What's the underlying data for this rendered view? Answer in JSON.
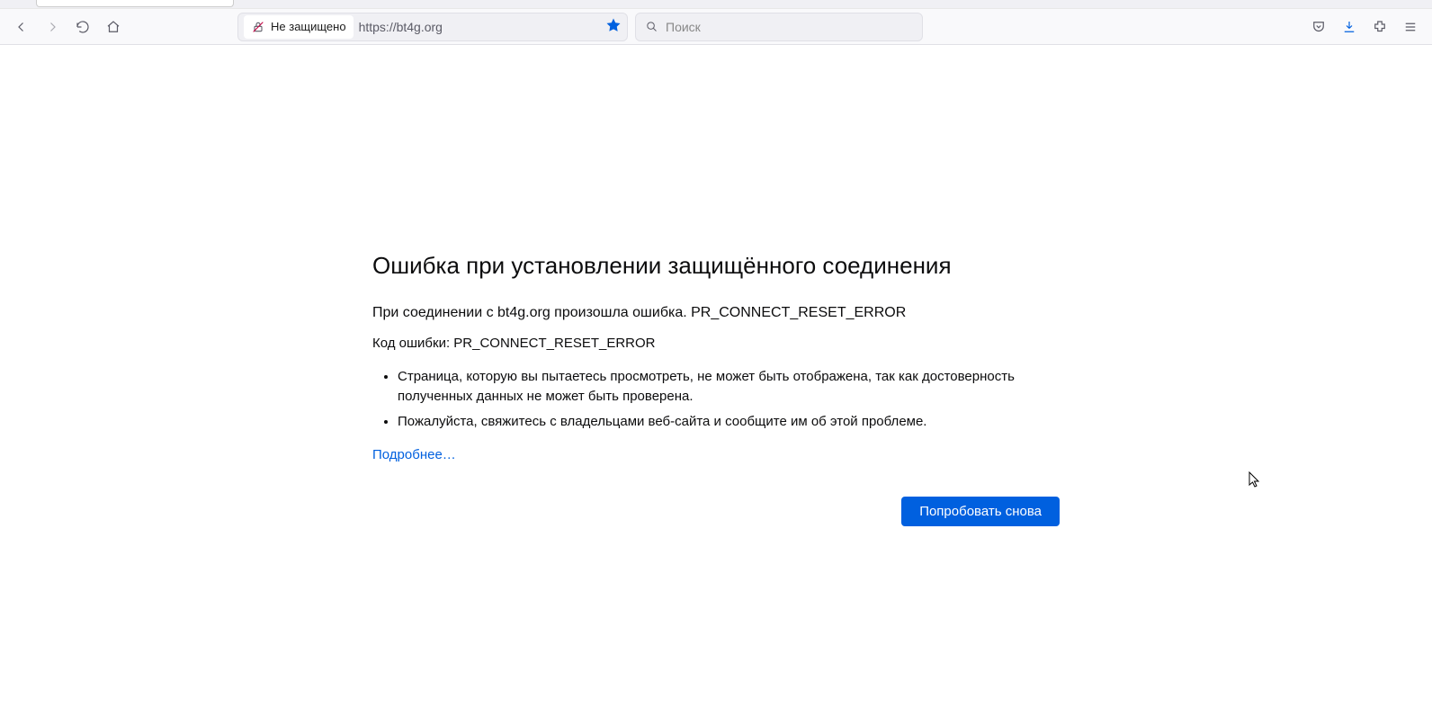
{
  "toolbar": {
    "security_label": "Не защищено",
    "url": "https://bt4g.org",
    "search_placeholder": "Поиск"
  },
  "error": {
    "title": "Ошибка при установлении защищённого соединения",
    "description": "При соединении с bt4g.org произошла ошибка. PR_CONNECT_RESET_ERROR",
    "code_line": "Код ошибки: PR_CONNECT_RESET_ERROR",
    "bullet1": "Страница, которую вы пытаетесь просмотреть, не может быть отображена, так как достоверность полученных данных не может быть проверена.",
    "bullet2": "Пожалуйста, свяжитесь с владельцами веб-сайта и сообщите им об этой проблеме.",
    "learn_more": "Подробнее…",
    "retry_label": "Попробовать снова"
  }
}
